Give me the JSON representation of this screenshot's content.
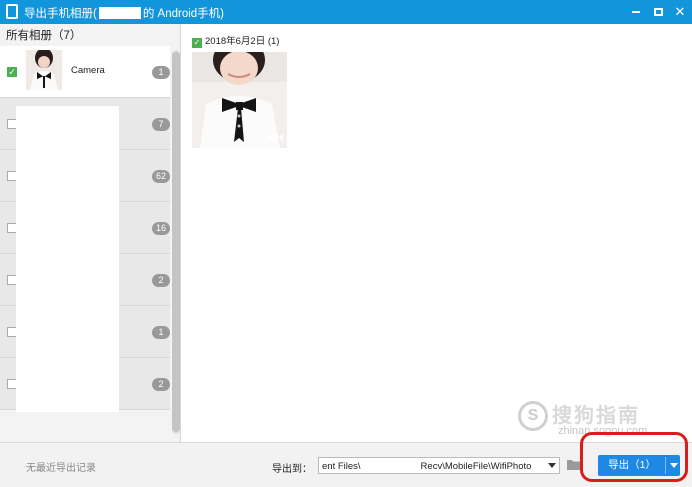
{
  "window": {
    "title_prefix": "导出手机相册(",
    "title_suffix": "的 Android手机)",
    "minimize_icon": "minimize-icon",
    "maximize_icon": "maximize-icon",
    "close_glyph": "✕"
  },
  "sidebar": {
    "header": "所有相册（7）",
    "albums": [
      {
        "name": "Camera",
        "count": "1",
        "checked": true
      },
      {
        "name": "",
        "count": "7",
        "checked": false
      },
      {
        "name": "",
        "count": "62",
        "checked": false
      },
      {
        "name": "",
        "count": "16",
        "checked": false
      },
      {
        "name": "",
        "count": "2",
        "checked": false
      },
      {
        "name": "",
        "count": "1",
        "checked": false
      },
      {
        "name": "",
        "count": "2",
        "checked": false
      }
    ]
  },
  "content": {
    "groups": [
      {
        "date_label": "2018年6月2日 (1)",
        "checked": true,
        "photos": [
          {
            "type": "video"
          }
        ]
      }
    ]
  },
  "footer": {
    "recent_label": "无最近导出记录",
    "export_to_label": "导出到：",
    "path_part1": "ent Files\\",
    "path_part2": "Recv\\MobileFile\\WifiPhoto",
    "export_button": "导出（1）"
  },
  "watermark": {
    "logo": "S",
    "text": "搜狗指南",
    "url": "zhinan.sogou.com"
  },
  "colors": {
    "titlebar": "#1296db",
    "accent": "#1e88e5",
    "check": "#4caf50",
    "annotation": "#d71e1e"
  }
}
